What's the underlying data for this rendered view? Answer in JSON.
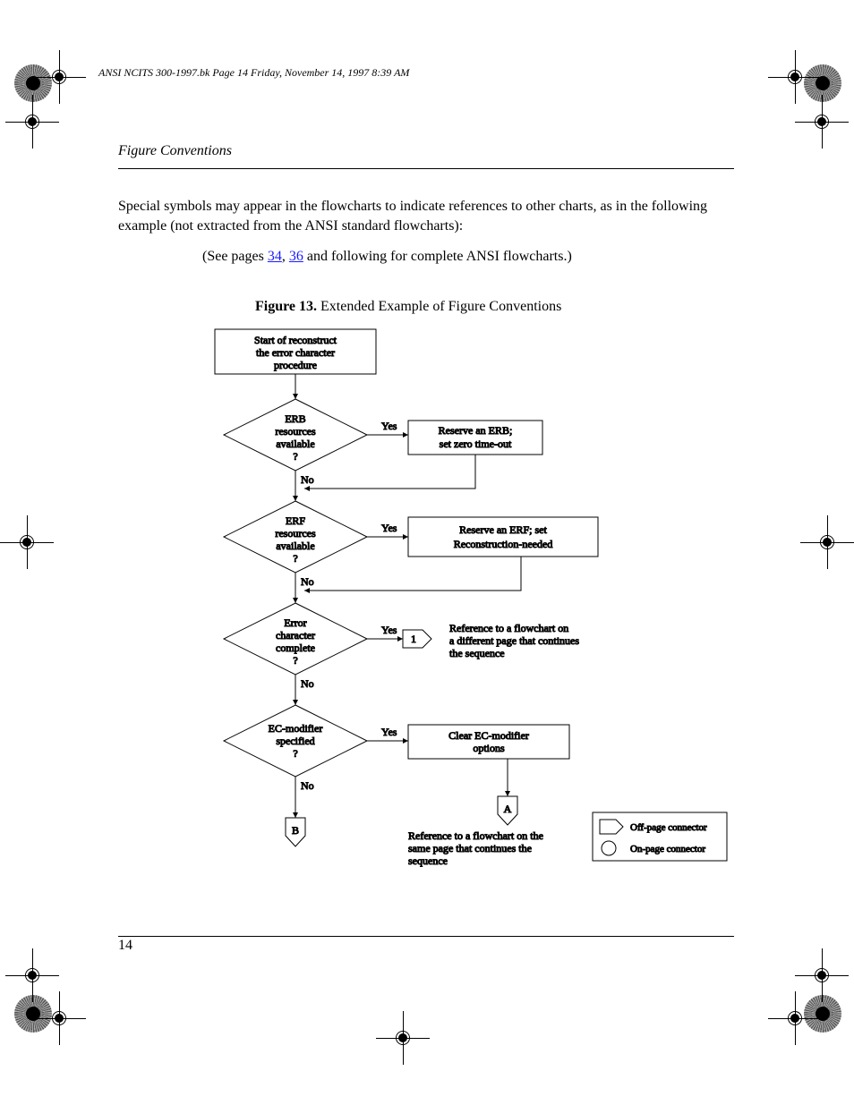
{
  "header": {
    "title": "Figure Conventions"
  },
  "body": {
    "intro": "Special symbols may appear in the flowcharts to indicate references to other charts, as in the following example (not extracted from the ANSI standard flowcharts):",
    "example_note": "(See pages ",
    "link1": "34",
    "example_sep": ", ",
    "link2": "36",
    "example_after": " and following for complete ANSI flowcharts.)"
  },
  "figure": {
    "caption_label": "Figure 13.",
    "caption_text": "Extended Example of Figure Conventions"
  },
  "chart_data": {
    "type": "flowchart",
    "nodes": [
      {
        "id": "start",
        "shape": "rect",
        "text": "Start of reconstruct\nthe error character\nprocedure"
      },
      {
        "id": "d1",
        "shape": "diamond",
        "text": "ERB\nresources\navailable\n?",
        "yes": "right",
        "no": "down"
      },
      {
        "id": "p1",
        "shape": "rect",
        "text": "Reserve an ERB;\nset zero time-out"
      },
      {
        "id": "d2",
        "shape": "diamond",
        "text": "ERF\nresources\navailable\n?",
        "yes": "right",
        "no": "down"
      },
      {
        "id": "p2",
        "shape": "rect",
        "text": "Reserve an ERF; set\nReconstruction-needed"
      },
      {
        "id": "d3",
        "shape": "diamond",
        "text": "Error\ncharacter\ncomplete\n?",
        "yes": "right",
        "no": "down"
      },
      {
        "id": "off1",
        "shape": "offpage",
        "text": "1",
        "note_right": "Reference to a flowchart on\na different page that continues\nthe sequence"
      },
      {
        "id": "d4",
        "shape": "diamond",
        "text": "EC-modifier\nspecified\n?",
        "yes": "right",
        "no": "down"
      },
      {
        "id": "p3",
        "shape": "rect",
        "text": "Clear EC-modifier\noptions"
      },
      {
        "id": "onA",
        "shape": "onpage",
        "text": "A",
        "note_below": "Reference to a flowchart on the\nsame page that continues the\nsequence"
      },
      {
        "id": "onB",
        "shape": "onpage",
        "text": "B"
      }
    ],
    "legend": {
      "offpage": "Off-page connector",
      "onpage": "On-page connector"
    }
  },
  "legend": {
    "offpage": "Off-page connector",
    "onpage": "On-page connector"
  },
  "labels": {
    "yes": "Yes",
    "no": "No"
  },
  "annotations": {
    "off1_note_l1": "Reference to a flowchart on",
    "off1_note_l2": "a different page that continues",
    "off1_note_l3": "the sequence",
    "onA_note_l1": "Reference to a flowchart on the",
    "onA_note_l2": "same page that continues the",
    "onA_note_l3": "sequence"
  },
  "footer": {
    "page": "14",
    "note": "ANSI NCITS 300-1997.bk  Page 14  Friday, November 14, 1997  8:39 AM"
  }
}
